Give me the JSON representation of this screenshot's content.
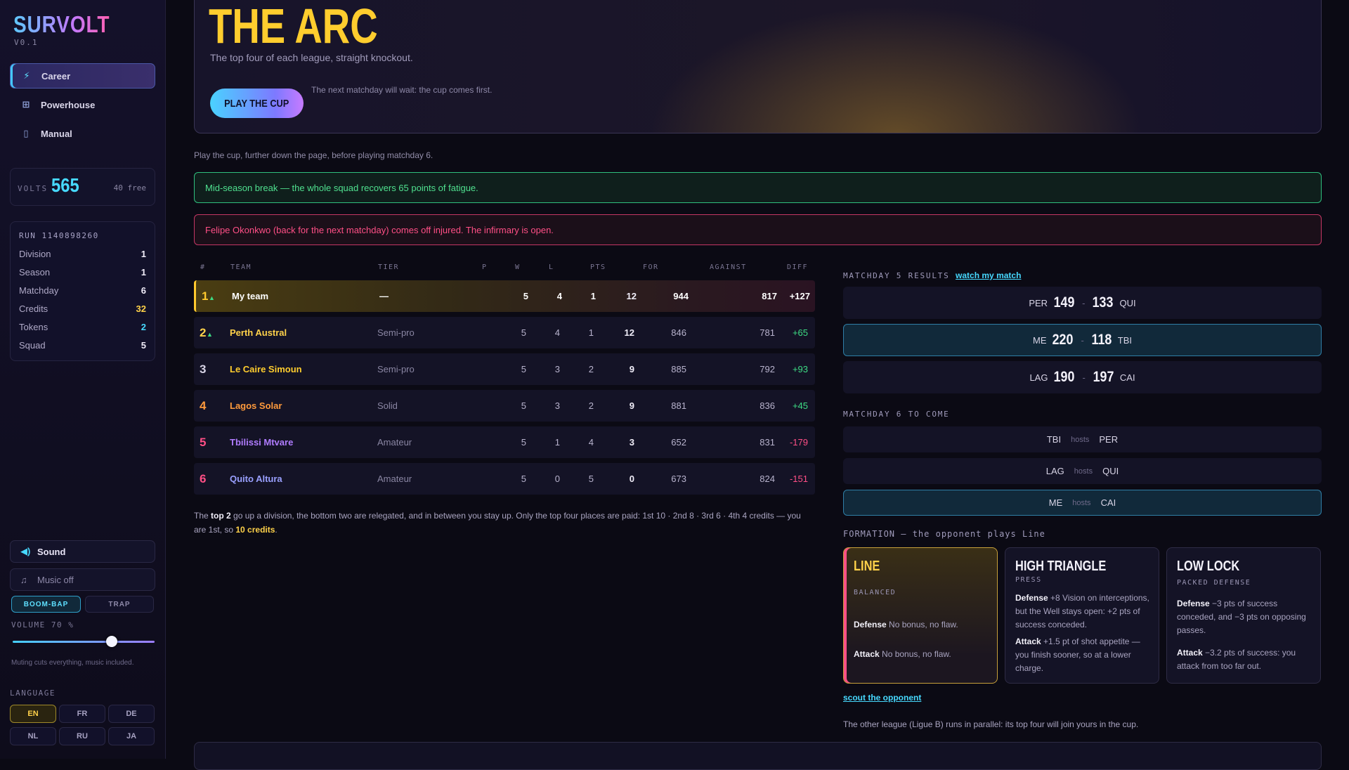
{
  "app": {
    "name": "SURVOLT",
    "version": "V0.1"
  },
  "nav": [
    {
      "label": "Career",
      "icon": "bolt-icon"
    },
    {
      "label": "Powerhouse",
      "icon": "plus-square-icon"
    },
    {
      "label": "Manual",
      "icon": "book-icon"
    }
  ],
  "volts": {
    "label": "VOLTS",
    "value": "565",
    "free": "40 free"
  },
  "run": {
    "title": "RUN 1140898260",
    "rows": [
      {
        "label": "Division",
        "value": "1"
      },
      {
        "label": "Season",
        "value": "1"
      },
      {
        "label": "Matchday",
        "value": "6"
      },
      {
        "label": "Credits",
        "value": "32"
      },
      {
        "label": "Tokens",
        "value": "2"
      },
      {
        "label": "Squad",
        "value": "5"
      }
    ]
  },
  "audio": {
    "sound": "Sound",
    "music": "Music off",
    "styles": [
      "BOOM-BAP",
      "TRAP"
    ],
    "volume_label": "VOLUME 70 %",
    "volume": 0.7,
    "mute_note": "Muting cuts everything, music included."
  },
  "language": {
    "label": "LANGUAGE",
    "options": [
      "EN",
      "FR",
      "DE",
      "NL",
      "RU",
      "JA"
    ],
    "selected": "EN"
  },
  "hero": {
    "title": "THE ARC",
    "subtitle": "The top four of each league, straight knockout.",
    "button": "PLAY THE CUP",
    "note": "The next matchday will wait: the cup comes first."
  },
  "hint": "Play the cup, further down the page, before playing matchday 6.",
  "alerts": {
    "green": "Mid-season break — the whole squad recovers 65 points of fatigue.",
    "red": "Felipe Okonkwo (back for the next matchday) comes off injured. The infirmary is open."
  },
  "table": {
    "headers": [
      "#",
      "TEAM",
      "TIER",
      "P",
      "W",
      "L",
      "PTS",
      "FOR",
      "AGAINST",
      "DIFF"
    ],
    "rows": [
      {
        "rank": "1",
        "up": "▲",
        "team": "My team",
        "tier": "—",
        "p": "5",
        "w": "4",
        "l": "1",
        "pts": "12",
        "for": "944",
        "against": "817",
        "diff": "+127"
      },
      {
        "rank": "2",
        "up": "▲",
        "team": "Perth Austral",
        "tier": "Semi-pro",
        "p": "5",
        "w": "4",
        "l": "1",
        "pts": "12",
        "for": "846",
        "against": "781",
        "diff": "+65"
      },
      {
        "rank": "3",
        "up": "",
        "team": "Le Caire Simoun",
        "tier": "Semi-pro",
        "p": "5",
        "w": "3",
        "l": "2",
        "pts": "9",
        "for": "885",
        "against": "792",
        "diff": "+93"
      },
      {
        "rank": "4",
        "up": "",
        "team": "Lagos Solar",
        "tier": "Solid",
        "p": "5",
        "w": "3",
        "l": "2",
        "pts": "9",
        "for": "881",
        "against": "836",
        "diff": "+45"
      },
      {
        "rank": "5",
        "up": "",
        "team": "Tbilissi Mtvare",
        "tier": "Amateur",
        "p": "5",
        "w": "1",
        "l": "4",
        "pts": "3",
        "for": "652",
        "against": "831",
        "diff": "-179"
      },
      {
        "rank": "6",
        "up": "",
        "team": "Quito Altura",
        "tier": "Amateur",
        "p": "5",
        "w": "0",
        "l": "5",
        "pts": "0",
        "for": "673",
        "against": "824",
        "diff": "-151"
      }
    ],
    "footer": {
      "pre": "The ",
      "bold": "top 2",
      "mid": " go up a division, the bottom two are relegated, and in between you stay up. Only the top four places are paid: 1st 10 · 2nd 8 · 3rd 6 · 4th 4 credits — you are 1st, so ",
      "credits": "10 credits",
      "post": "."
    }
  },
  "results": {
    "title": "MATCHDAY 5 RESULTS",
    "link": "watch my match",
    "matches": [
      {
        "home": "PER",
        "hs": "149",
        "as": "133",
        "away": "QUI",
        "mine": false
      },
      {
        "home": "ME",
        "hs": "220",
        "as": "118",
        "away": "TBI",
        "mine": true
      },
      {
        "home": "LAG",
        "hs": "190",
        "as": "197",
        "away": "CAI",
        "mine": false
      }
    ]
  },
  "fixtures": {
    "title": "MATCHDAY 6 TO COME",
    "hosts": "hosts",
    "games": [
      {
        "home": "TBI",
        "away": "PER",
        "mine": false
      },
      {
        "home": "LAG",
        "away": "QUI",
        "mine": false
      },
      {
        "home": "ME",
        "away": "CAI",
        "mine": true
      }
    ]
  },
  "formation": {
    "title": "FORMATION — the opponent plays Line",
    "cards": [
      {
        "name": "LINE",
        "kind": "BALANCED",
        "def_l": "Defense",
        "def": " No bonus, no flaw.",
        "att_l": "Attack",
        "att": " No bonus, no flaw."
      },
      {
        "name": "HIGH TRIANGLE",
        "kind": "PRESS",
        "def_l": "Defense",
        "def": " +8 Vision on interceptions, but the Well stays open: +2 pts of success conceded.",
        "att_l": "Attack",
        "att": " +1.5 pt of shot appetite — you finish sooner, so at a lower charge."
      },
      {
        "name": "LOW LOCK",
        "kind": "PACKED DEFENSE",
        "def_l": "Defense",
        "def": " −3 pts of success conceded, and −3 pts on opposing passes.",
        "att_l": "Attack",
        "att": " −3.2 pts of success: you attack from too far out."
      }
    ],
    "scout": "scout the opponent"
  },
  "other_league": "The other league (Ligue B) runs in parallel: its top four will join yours in the cup.",
  "colors": {
    "accent": "#47d9ff",
    "gold": "#ffcd2e",
    "green": "#3ddc84",
    "red": "#ff4f86"
  }
}
